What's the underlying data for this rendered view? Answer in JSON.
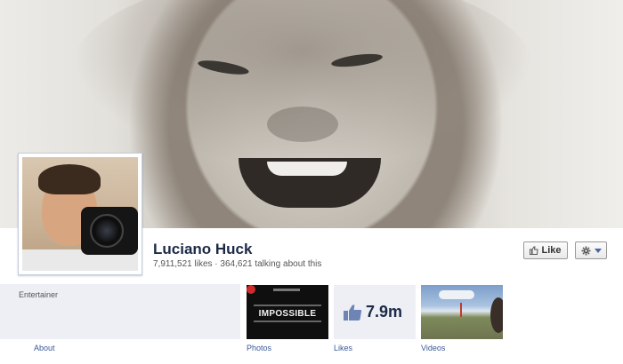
{
  "page": {
    "name": "Luciano Huck",
    "stats": "7,911,521 likes · 364,621 talking about this",
    "category": "Entertainer"
  },
  "actions": {
    "like_label": "Like",
    "like_icon": "thumbs-up-icon",
    "settings_icon": "gear-icon"
  },
  "tiles": {
    "photos": {
      "label": "Photos",
      "caption": "IMPOSSIBLE"
    },
    "likes": {
      "label": "Likes",
      "count": "7.9m"
    },
    "videos": {
      "label": "Videos"
    }
  },
  "nav": {
    "about_label": "About"
  },
  "colors": {
    "link": "#3b5998",
    "name": "#1c2a47",
    "panel": "#edeff4"
  }
}
